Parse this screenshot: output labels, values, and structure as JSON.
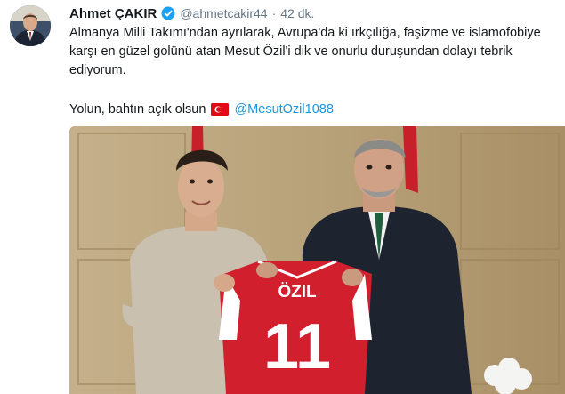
{
  "user": {
    "display_name": "Ahmet ÇAKIR",
    "handle": "@ahmetcakir44",
    "separator": "·",
    "timestamp": "42 dk.",
    "avatar_icon": "profile-photo",
    "verified_icon": "verified-badge-icon"
  },
  "tweet": {
    "lines": [
      "Almanya Milli Takımı'ndan ayrılarak, Avrupa'da ki ırkçılığa, faşizme ve islamofobiye",
      "karşı en güzel golünü atan Mesut Özil'i dik ve onurlu duruşundan dolayı tebrik",
      "ediyorum."
    ],
    "closing": "Yolun, bahtın açık olsun",
    "flag_icon": "turkish-flag-icon",
    "mention": "@MesutOzil1088"
  },
  "photo": {
    "jersey_name": "ÖZIL",
    "jersey_number": "11"
  },
  "colors": {
    "text": "#14171a",
    "secondary": "#657786",
    "link": "#1b95e0",
    "verified": "#1da1f2",
    "flag_red": "#e30a17"
  }
}
